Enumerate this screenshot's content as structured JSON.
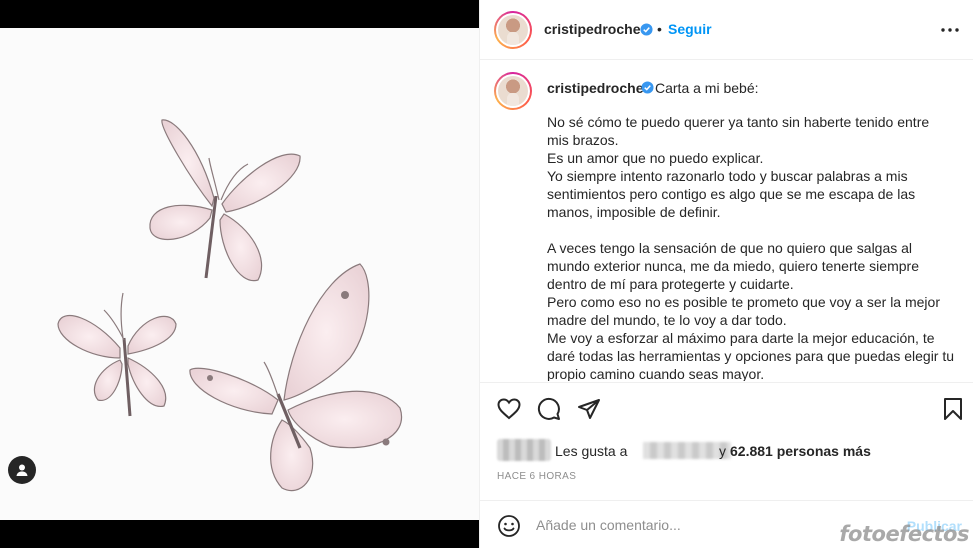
{
  "colors": {
    "accent": "#0095f6",
    "verified": "#3897f0",
    "text": "#262626",
    "muted": "#8e8e8e",
    "publish_disabled": "#b2dffc"
  },
  "header": {
    "username": "cristipedroche",
    "separator": "•",
    "follow_label": "Seguir",
    "more_icon": "more-horizontal-icon"
  },
  "caption": {
    "username": "cristipedroche",
    "title": "Carta a mi bebé:",
    "body": "No sé cómo te puedo querer ya tanto sin haberte tenido entre\nmis brazos.\nEs un amor que no puedo explicar.\nYo siempre intento razonarlo todo y buscar palabras a mis\nsentimientos pero contigo es algo que se me escapa de las\nmanos, imposible de definir.\n\nA veces tengo la sensación de que no quiero que salgas al\nmundo exterior nunca, me da miedo, quiero tenerte siempre\ndentro de mí para protegerte y cuidarte.\nPero como eso no es posible te prometo que voy a ser la mejor\nmadre del mundo, te lo voy a dar todo.\nMe voy a esforzar al máximo para darte la mejor educación, te\ndaré todas las herramientas y opciones para que puedas elegir tu\npropio camino cuando seas mayor."
  },
  "actions": {
    "icons": [
      "heart-icon",
      "comment-icon",
      "share-icon",
      "bookmark-icon"
    ],
    "likes_prefix": "Les gusta a",
    "likes_connector": "y",
    "likes_count": "62.881 personas más",
    "timestamp": "HACE 6 HORAS"
  },
  "comment": {
    "placeholder": "Añade un comentario...",
    "publish_label": "Publicar",
    "emoji_icon": "smiley-icon"
  },
  "media": {
    "user_tag_icon": "user-tag-icon"
  },
  "watermark": "fotoefectos"
}
